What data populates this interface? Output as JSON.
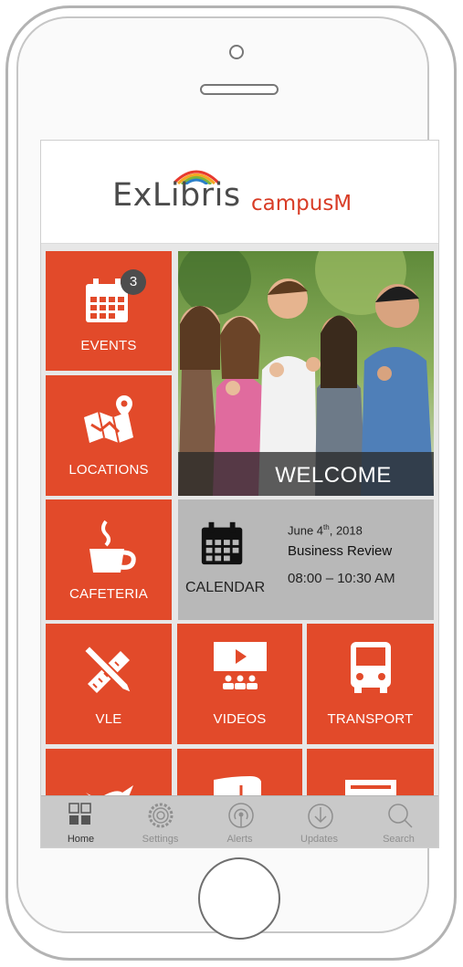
{
  "brand": {
    "name_main": "ExLibris",
    "name_sub": "campusM"
  },
  "tiles": {
    "events": {
      "label": "EVENTS",
      "badge": "3"
    },
    "locations": {
      "label": "LOCATIONS"
    },
    "cafeteria": {
      "label": "CAFETERIA"
    },
    "welcome": {
      "label": "WELCOME"
    },
    "calendar": {
      "label": "CALENDAR",
      "date_day": "June 4",
      "date_suffix": "th",
      "date_year": ", 2018",
      "event_title": "Business Review",
      "event_time": "08:00 – 10:30 AM"
    },
    "vle": {
      "label": "VLE"
    },
    "videos": {
      "label": "VIDEOS"
    },
    "transport": {
      "label": "TRANSPORT"
    }
  },
  "tabbar": {
    "items": [
      {
        "label": "Home",
        "icon": "grid-icon",
        "active": true
      },
      {
        "label": "Settings",
        "icon": "gear-icon",
        "active": false
      },
      {
        "label": "Alerts",
        "icon": "broadcast-icon",
        "active": false
      },
      {
        "label": "Updates",
        "icon": "download-icon",
        "active": false
      },
      {
        "label": "Search",
        "icon": "search-icon",
        "active": false
      }
    ]
  },
  "colors": {
    "tile": "#e24a2a",
    "brand_red": "#d83c26",
    "calendar_bg": "#b8b8b8",
    "tabbar_bg": "#c9c9c9"
  }
}
